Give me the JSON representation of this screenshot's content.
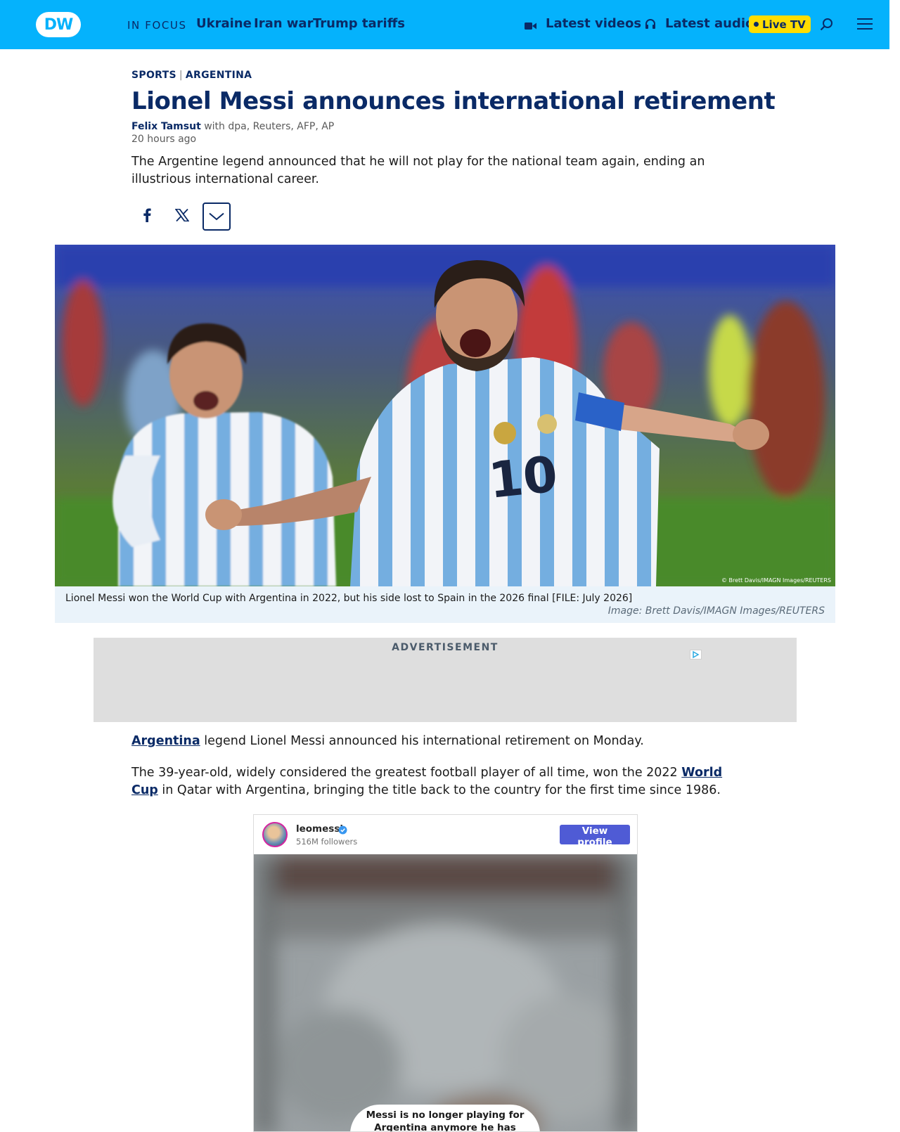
{
  "header": {
    "logo_text": "DW",
    "in_focus_label": "IN FOCUS",
    "topics": [
      "Ukraine",
      "Iran war",
      "Trump tariffs"
    ],
    "latest_videos": "Latest videos",
    "latest_audio": "Latest audio",
    "live_tv": "Live TV",
    "icons": [
      "video-camera-icon",
      "headphones-icon",
      "search-icon",
      "hamburger-menu-icon"
    ],
    "colors": {
      "bar": "#05b2fc",
      "text": "#0a2a66",
      "live_badge": "#ffdd00"
    }
  },
  "article": {
    "kicker_section": "SPORTS",
    "kicker_divider": "|",
    "kicker_topic": "ARGENTINA",
    "title": "Lionel Messi announces international retirement",
    "author": "Felix Tamsut",
    "agencies": "with dpa, Reuters, AFP, AP",
    "time_ago": "20 hours ago",
    "teaser": "The Argentine legend announced that he will not play for the national team again, ending an illustrious international career.",
    "share_icons": [
      "facebook-icon",
      "x-icon",
      "chevron-down-icon"
    ]
  },
  "hero": {
    "watermark": "© Brett Davis/IMAGN Images/REUTERS",
    "caption": "Lionel Messi won the World Cup with Argentina in 2022, but his side lost to Spain in the 2026 final [FILE: July 2026]",
    "credit": "Image: Brett Davis/IMAGN Images/REUTERS"
  },
  "ad": {
    "label": "ADVERTISEMENT"
  },
  "body": {
    "p1_link": "Argentina",
    "p1_rest": " legend Lionel Messi announced his international retirement on Monday.",
    "p2_start": "The 39-year-old, widely considered the greatest football player of all time, won the 2022 ",
    "p2_link": "World Cup",
    "p2_rest": " in Qatar with Argentina, bringing the title back to the country for the first time since 1986."
  },
  "instagram": {
    "handle": "leomessi",
    "followers": "516M followers",
    "view_profile": "View profile",
    "bubble_text": "Messi is no longer playing for Argentina anymore he has officially retired from international football."
  }
}
